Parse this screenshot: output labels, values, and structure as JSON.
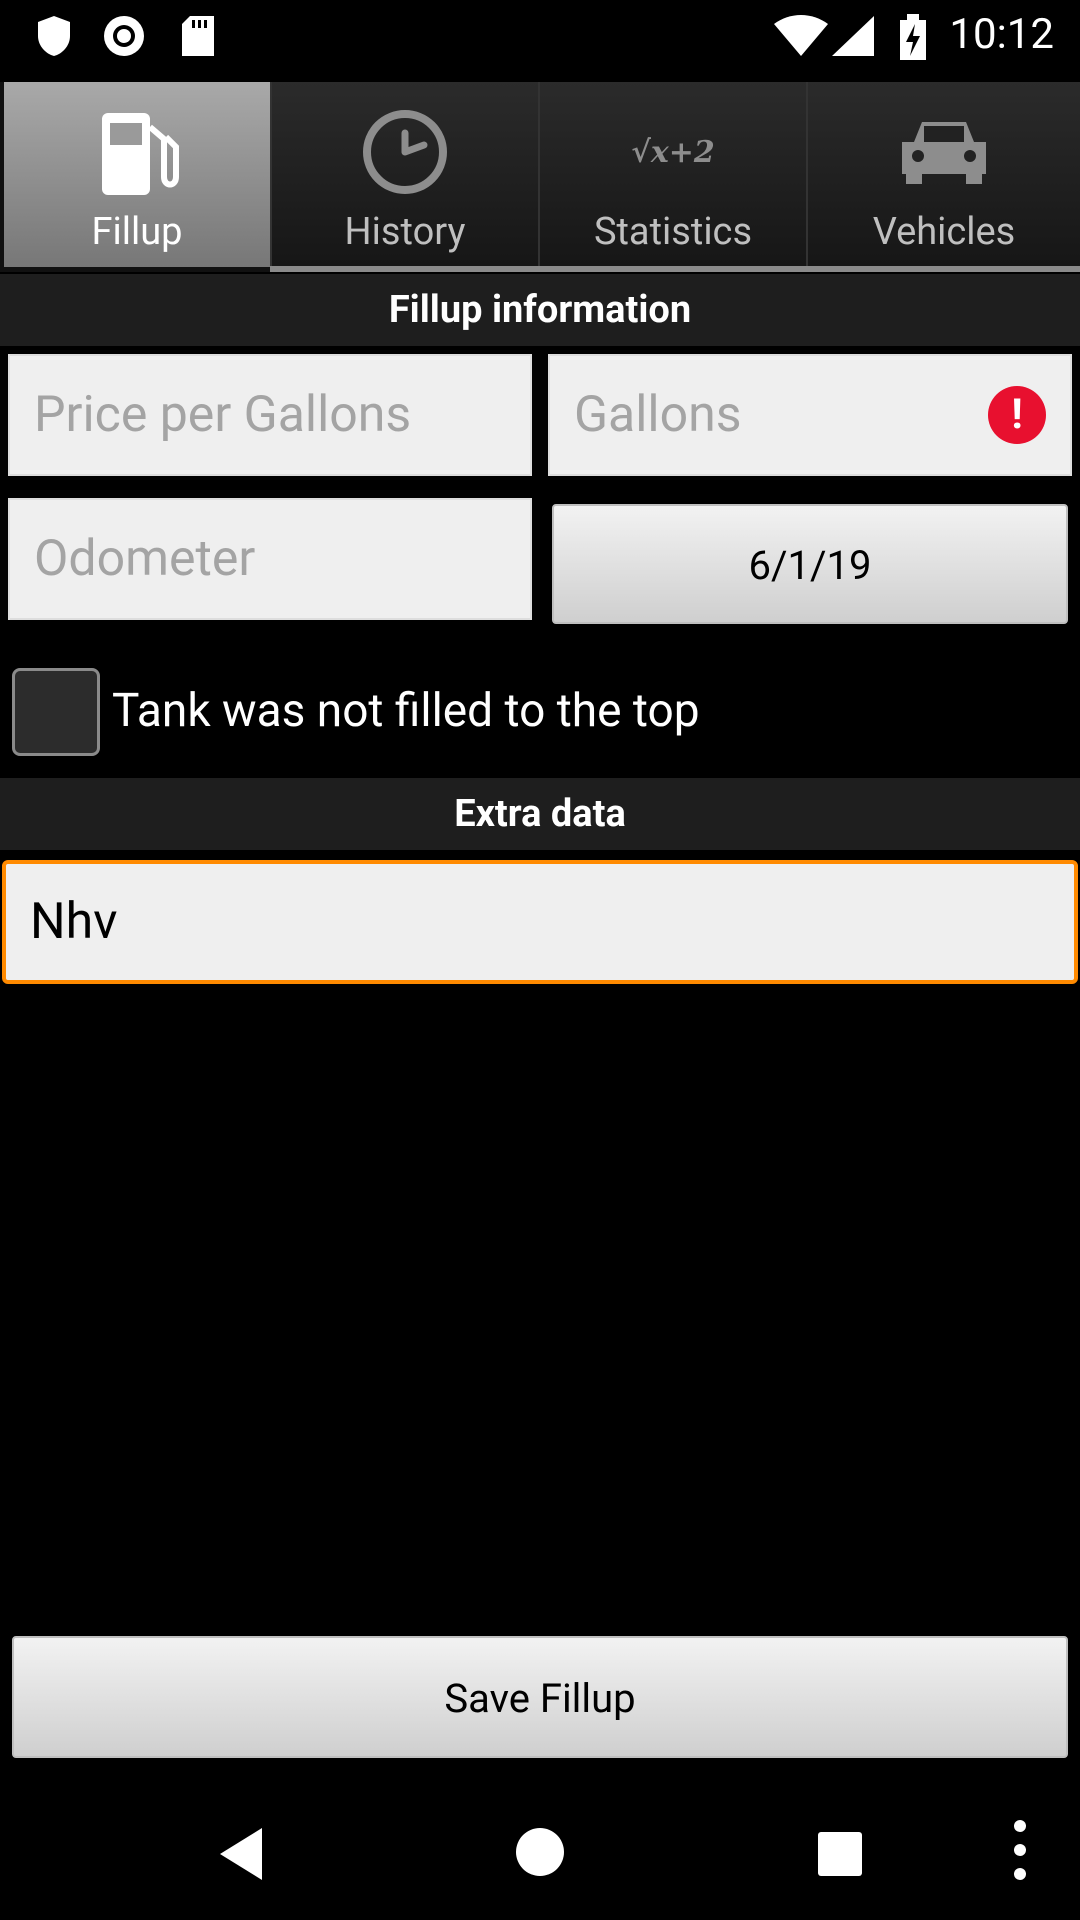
{
  "status_bar": {
    "time": "10:12",
    "icons": [
      "shield-icon",
      "record-icon",
      "sd-card-icon",
      "wifi-icon",
      "signal-icon",
      "battery-charging-icon"
    ]
  },
  "tabs": [
    {
      "label": "Fillup",
      "icon": "fuel-pump-icon",
      "active": true
    },
    {
      "label": "History",
      "icon": "clock-icon",
      "active": false
    },
    {
      "label": "Statistics",
      "icon": "formula-icon",
      "icon_text": "√x+2",
      "active": false
    },
    {
      "label": "Vehicles",
      "icon": "car-icon",
      "active": false
    }
  ],
  "fillup_section": {
    "title": "Fillup information",
    "price_per_gallon": {
      "placeholder": "Price per Gallons",
      "value": ""
    },
    "gallons": {
      "placeholder": "Gallons",
      "value": "",
      "error": true
    },
    "odometer": {
      "placeholder": "Odometer",
      "value": ""
    },
    "date_button": "6/1/19",
    "partial_fill": {
      "label": "Tank was not filled to the top",
      "checked": false
    }
  },
  "extra_section": {
    "title": "Extra data",
    "extra_input": {
      "value": "Nhv"
    }
  },
  "save_button": "Save Fillup",
  "colors": {
    "focus_border": "#ff8a00",
    "error_red": "#e8102f",
    "background": "#000000"
  }
}
